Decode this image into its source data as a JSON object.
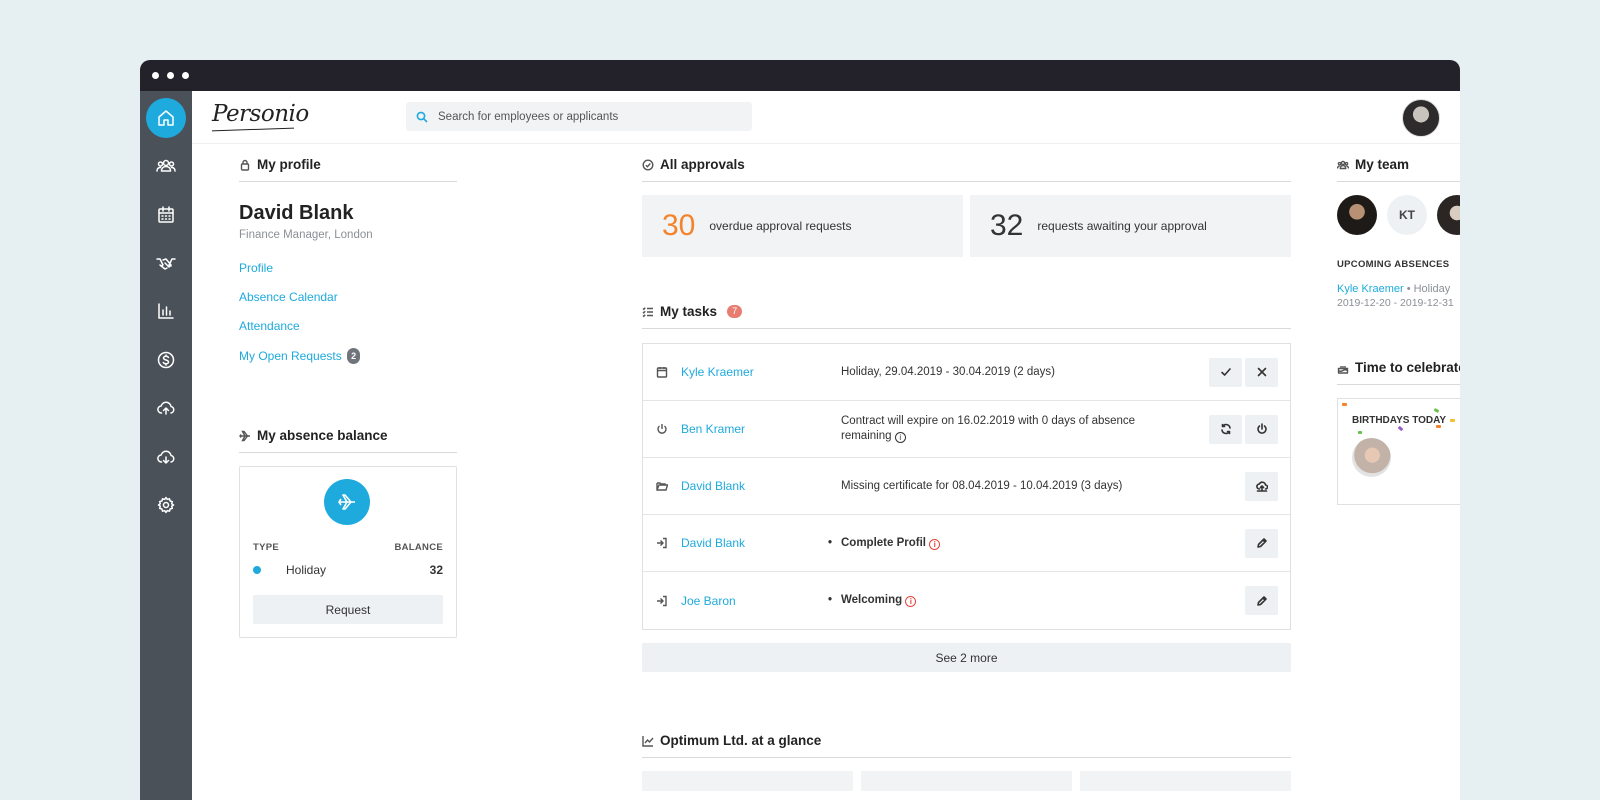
{
  "app": {
    "logo": "Personio",
    "search_placeholder": "Search for employees or applicants"
  },
  "sidebar": {
    "items": [
      {
        "icon": "home-icon",
        "active": true
      },
      {
        "icon": "people-icon"
      },
      {
        "icon": "calendar-icon"
      },
      {
        "icon": "handshake-icon"
      },
      {
        "icon": "bar-chart-icon"
      },
      {
        "icon": "dollar-icon"
      },
      {
        "icon": "cloud-upload-icon"
      },
      {
        "icon": "cloud-download-icon"
      },
      {
        "icon": "gear-icon"
      }
    ]
  },
  "profile": {
    "section_title": "My profile",
    "name": "David Blank",
    "job": "Finance Manager, London",
    "links": {
      "profile": "Profile",
      "absence_calendar": "Absence Calendar",
      "attendance": "Attendance",
      "open_requests": "My Open Requests",
      "open_requests_count": "2"
    }
  },
  "absence": {
    "section_title": "My absence balance",
    "type_header": "TYPE",
    "balance_header": "BALANCE",
    "type": "Holiday",
    "balance": "32",
    "request_button": "Request"
  },
  "approvals": {
    "section_title": "All approvals",
    "overdue_count": "30",
    "overdue_text": "overdue approval requests",
    "awaiting_count": "32",
    "awaiting_text": "requests awaiting your approval"
  },
  "tasks": {
    "section_title": "My tasks",
    "count": "7",
    "rows": [
      {
        "icon": "calendar-icon",
        "person": "Kyle Kraemer",
        "desc": "Holiday, 29.04.2019 - 30.04.2019 (2 days)"
      },
      {
        "icon": "power-icon",
        "person": "Ben Kramer",
        "desc": "Contract will expire on 16.02.2019 with 0 days of absence remaining"
      },
      {
        "icon": "folder-icon",
        "person": "David Blank",
        "desc": "Missing certificate for 08.04.2019 - 10.04.2019 (3 days)"
      },
      {
        "icon": "login-icon",
        "person": "David Blank",
        "desc": "Complete Profil"
      },
      {
        "icon": "login-icon",
        "person": "Joe Baron",
        "desc": "Welcoming"
      }
    ],
    "see_more": "See 2 more"
  },
  "glance": {
    "section_title": "Optimum Ltd. at a glance"
  },
  "team": {
    "section_title": "My team",
    "initials": "KT",
    "upcoming_label": "UPCOMING ABSENCES",
    "absence_person": "Kyle Kraemer",
    "absence_type": "• Holiday",
    "absence_dates": "2019-12-20 - 2019-12-31"
  },
  "celebrate": {
    "section_title": "Time to celebrate",
    "birthdays_label": "BIRTHDAYS TODAY"
  },
  "colors": {
    "accent": "#1eaadd",
    "overdue": "#f5832b",
    "sidebar": "#4a5158",
    "badge": "#e87c70"
  }
}
